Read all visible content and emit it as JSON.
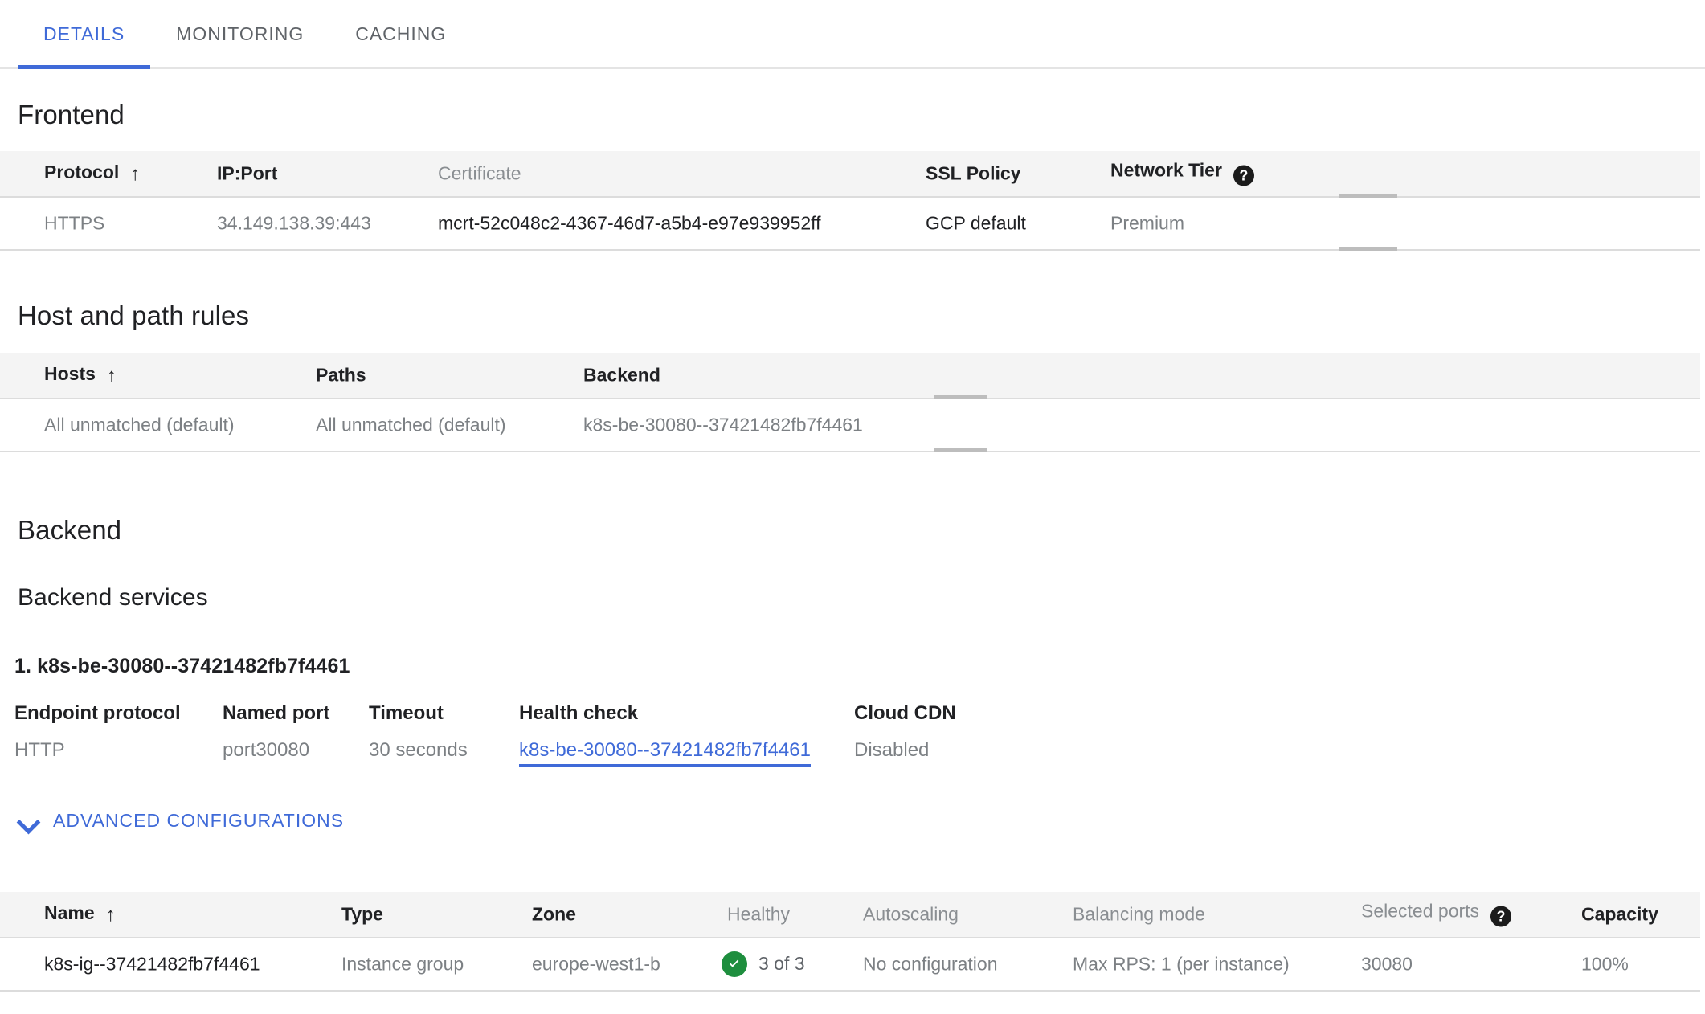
{
  "tabs": [
    {
      "label": "DETAILS",
      "active": true
    },
    {
      "label": "MONITORING",
      "active": false
    },
    {
      "label": "CACHING",
      "active": false
    }
  ],
  "frontend": {
    "title": "Frontend",
    "columns": [
      "Protocol",
      "IP:Port",
      "Certificate",
      "SSL Policy",
      "Network Tier"
    ],
    "sorted_column": "Protocol",
    "sort_direction": "ascending",
    "help_icon": "help-icon",
    "rows": [
      {
        "protocol": "HTTPS",
        "ip_port": "34.149.138.39:443",
        "certificate": "mcrt-52c048c2-4367-46d7-a5b4-e97e939952ff",
        "ssl_policy": "GCP default",
        "network_tier": "Premium"
      }
    ]
  },
  "host_path_rules": {
    "title": "Host and path rules",
    "columns": [
      "Hosts",
      "Paths",
      "Backend"
    ],
    "sorted_column": "Hosts",
    "sort_direction": "ascending",
    "rows": [
      {
        "hosts": "All unmatched (default)",
        "paths": "All unmatched (default)",
        "backend": "k8s-be-30080--37421482fb7f4461"
      }
    ]
  },
  "backend": {
    "title": "Backend",
    "services_title": "Backend services",
    "service": {
      "heading": "1. k8s-be-30080--37421482fb7f4461",
      "fields": [
        {
          "label": "Endpoint protocol",
          "value": "HTTP",
          "is_link": false
        },
        {
          "label": "Named port",
          "value": "port30080",
          "is_link": false
        },
        {
          "label": "Timeout",
          "value": "30 seconds",
          "is_link": false
        },
        {
          "label": "Health check",
          "value": "k8s-be-30080--37421482fb7f4461",
          "is_link": true
        },
        {
          "label": "Cloud CDN",
          "value": "Disabled",
          "is_link": false
        }
      ]
    },
    "advanced_label": "ADVANCED CONFIGURATIONS",
    "advanced_chevron": "chevron-down-icon",
    "instances_table": {
      "columns": [
        "Name",
        "Type",
        "Zone",
        "Healthy",
        "Autoscaling",
        "Balancing mode",
        "Selected ports",
        "Capacity"
      ],
      "sorted_column": "Name",
      "sort_direction": "ascending",
      "help_icon": "help-icon",
      "rows": [
        {
          "name": "k8s-ig--37421482fb7f4461",
          "type": "Instance group",
          "zone": "europe-west1-b",
          "healthy": "3 of 3",
          "healthy_status": "ok",
          "autoscaling": "No configuration",
          "balancing_mode": "Max RPS: 1 (per instance)",
          "selected_ports": "30080",
          "capacity": "100%"
        }
      ]
    }
  },
  "colors": {
    "accent_blue": "#3f6ad8",
    "healthy_green": "#1e8e3e",
    "header_bg": "#f4f4f4",
    "divider": "#dcdcdc",
    "text_primary": "#202124",
    "text_secondary": "#7c8084"
  }
}
